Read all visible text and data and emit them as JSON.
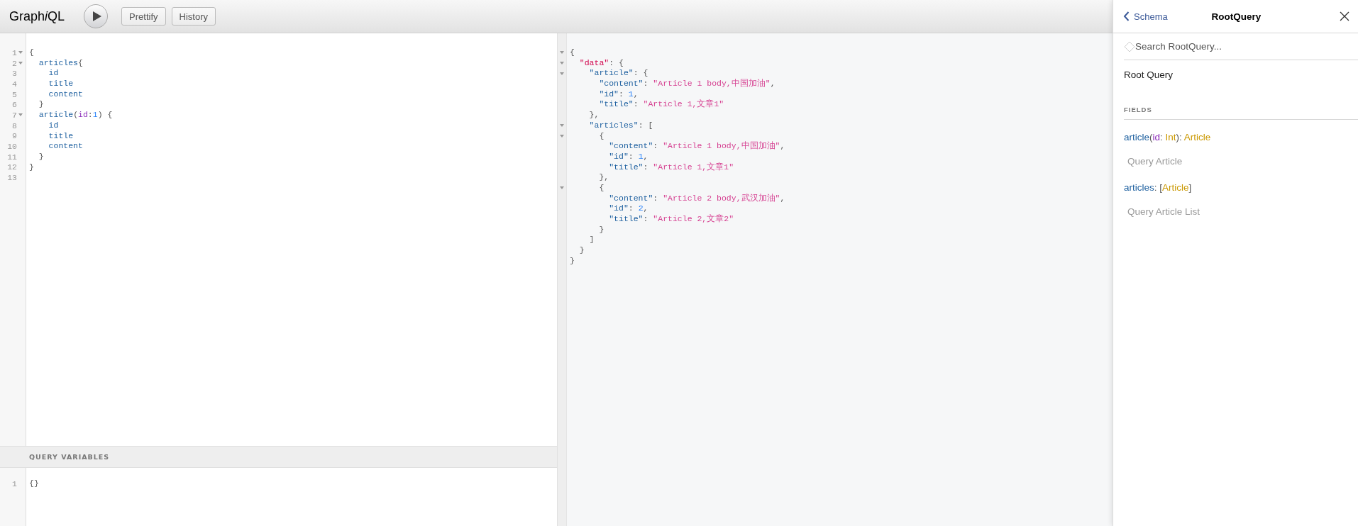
{
  "toolbar": {
    "title": [
      {
        "text": "Graph",
        "italic": false
      },
      {
        "text": "i",
        "italic": true
      },
      {
        "text": "QL",
        "italic": false
      }
    ],
    "buttons": [
      {
        "label": "Prettify"
      },
      {
        "label": "History"
      }
    ]
  },
  "query_editor": {
    "lines": [
      {
        "number": "1",
        "foldable": true,
        "tokens": [
          {
            "kind": "punct",
            "text": "{"
          }
        ]
      },
      {
        "number": "2",
        "foldable": true,
        "tokens": [
          {
            "kind": "field",
            "text": "  articles"
          },
          {
            "kind": "punct",
            "text": "{"
          }
        ]
      },
      {
        "number": "3",
        "foldable": false,
        "tokens": [
          {
            "kind": "field",
            "text": "    id"
          }
        ]
      },
      {
        "number": "4",
        "foldable": false,
        "tokens": [
          {
            "kind": "field",
            "text": "    title"
          }
        ]
      },
      {
        "number": "5",
        "foldable": false,
        "tokens": [
          {
            "kind": "field",
            "text": "    content"
          }
        ]
      },
      {
        "number": "6",
        "foldable": false,
        "tokens": [
          {
            "kind": "punct",
            "text": "  }"
          }
        ]
      },
      {
        "number": "7",
        "foldable": true,
        "tokens": [
          {
            "kind": "field",
            "text": "  article"
          },
          {
            "kind": "punct",
            "text": "("
          },
          {
            "kind": "attribute",
            "text": "id"
          },
          {
            "kind": "punct",
            "text": ":"
          },
          {
            "kind": "number",
            "text": "1"
          },
          {
            "kind": "punct",
            "text": ") {"
          }
        ]
      },
      {
        "number": "8",
        "foldable": false,
        "tokens": [
          {
            "kind": "field",
            "text": "    id"
          }
        ]
      },
      {
        "number": "9",
        "foldable": false,
        "tokens": [
          {
            "kind": "field",
            "text": "    title"
          }
        ]
      },
      {
        "number": "10",
        "foldable": false,
        "tokens": [
          {
            "kind": "field",
            "text": "    content"
          }
        ]
      },
      {
        "number": "11",
        "foldable": false,
        "tokens": [
          {
            "kind": "punct",
            "text": "  }"
          }
        ]
      },
      {
        "number": "12",
        "foldable": false,
        "tokens": [
          {
            "kind": "punct",
            "text": "}"
          }
        ]
      },
      {
        "number": "13",
        "foldable": false
      }
    ]
  },
  "variables": {
    "title": "QUERY VARIABLES",
    "lines": [
      {
        "number": "1",
        "tokens": [
          {
            "kind": "punct",
            "text": "{}"
          }
        ]
      }
    ]
  },
  "results": {
    "lines": [
      {
        "foldable": true,
        "tokens": [
          {
            "kind": "punct",
            "text": "{"
          }
        ]
      },
      {
        "foldable": true,
        "tokens": [
          {
            "kind": "def",
            "text": "  \"data\""
          },
          {
            "kind": "punct",
            "text": ": {"
          }
        ]
      },
      {
        "foldable": true,
        "tokens": [
          {
            "kind": "property",
            "text": "    \"article\""
          },
          {
            "kind": "punct",
            "text": ": {"
          }
        ]
      },
      {
        "foldable": false,
        "tokens": [
          {
            "kind": "property",
            "text": "      \"content\""
          },
          {
            "kind": "punct",
            "text": ": "
          },
          {
            "kind": "string",
            "text": "\"Article 1 body,中国加油\""
          },
          {
            "kind": "punct",
            "text": ","
          }
        ]
      },
      {
        "foldable": false,
        "tokens": [
          {
            "kind": "property",
            "text": "      \"id\""
          },
          {
            "kind": "punct",
            "text": ": "
          },
          {
            "kind": "number",
            "text": "1"
          },
          {
            "kind": "punct",
            "text": ","
          }
        ]
      },
      {
        "foldable": false,
        "tokens": [
          {
            "kind": "property",
            "text": "      \"title\""
          },
          {
            "kind": "punct",
            "text": ": "
          },
          {
            "kind": "string",
            "text": "\"Article 1,文章1\""
          }
        ]
      },
      {
        "foldable": false,
        "tokens": [
          {
            "kind": "punct",
            "text": "    },"
          }
        ]
      },
      {
        "foldable": true,
        "tokens": [
          {
            "kind": "property",
            "text": "    \"articles\""
          },
          {
            "kind": "punct",
            "text": ": ["
          }
        ]
      },
      {
        "foldable": true,
        "tokens": [
          {
            "kind": "punct",
            "text": "      {"
          }
        ]
      },
      {
        "foldable": false,
        "tokens": [
          {
            "kind": "property",
            "text": "        \"content\""
          },
          {
            "kind": "punct",
            "text": ": "
          },
          {
            "kind": "string",
            "text": "\"Article 1 body,中国加油\""
          },
          {
            "kind": "punct",
            "text": ","
          }
        ]
      },
      {
        "foldable": false,
        "tokens": [
          {
            "kind": "property",
            "text": "        \"id\""
          },
          {
            "kind": "punct",
            "text": ": "
          },
          {
            "kind": "number",
            "text": "1"
          },
          {
            "kind": "punct",
            "text": ","
          }
        ]
      },
      {
        "foldable": false,
        "tokens": [
          {
            "kind": "property",
            "text": "        \"title\""
          },
          {
            "kind": "punct",
            "text": ": "
          },
          {
            "kind": "string",
            "text": "\"Article 1,文章1\""
          }
        ]
      },
      {
        "foldable": false,
        "tokens": [
          {
            "kind": "punct",
            "text": "      },"
          }
        ]
      },
      {
        "foldable": true,
        "tokens": [
          {
            "kind": "punct",
            "text": "      {"
          }
        ]
      },
      {
        "foldable": false,
        "tokens": [
          {
            "kind": "property",
            "text": "        \"content\""
          },
          {
            "kind": "punct",
            "text": ": "
          },
          {
            "kind": "string",
            "text": "\"Article 2 body,武汉加油\""
          },
          {
            "kind": "punct",
            "text": ","
          }
        ]
      },
      {
        "foldable": false,
        "tokens": [
          {
            "kind": "property",
            "text": "        \"id\""
          },
          {
            "kind": "punct",
            "text": ": "
          },
          {
            "kind": "number",
            "text": "2"
          },
          {
            "kind": "punct",
            "text": ","
          }
        ]
      },
      {
        "foldable": false,
        "tokens": [
          {
            "kind": "property",
            "text": "        \"title\""
          },
          {
            "kind": "punct",
            "text": ": "
          },
          {
            "kind": "string",
            "text": "\"Article 2,文章2\""
          }
        ]
      },
      {
        "foldable": false,
        "tokens": [
          {
            "kind": "punct",
            "text": "      }"
          }
        ]
      },
      {
        "foldable": false,
        "tokens": [
          {
            "kind": "punct",
            "text": "    ]"
          }
        ]
      },
      {
        "foldable": false,
        "tokens": [
          {
            "kind": "punct",
            "text": "  }"
          }
        ]
      },
      {
        "foldable": false,
        "tokens": [
          {
            "kind": "punct",
            "text": "}"
          }
        ]
      }
    ]
  },
  "docs": {
    "back_label": "Schema",
    "title": "RootQuery",
    "search": {
      "placeholder": "Search RootQuery..."
    },
    "description": "Root Query",
    "section_title": "FIELDS",
    "fields": [
      {
        "signature": [
          {
            "kind": "field",
            "text": "article"
          },
          {
            "kind": "punct",
            "text": "("
          },
          {
            "kind": "arg",
            "text": "id"
          },
          {
            "kind": "punct",
            "text": ": "
          },
          {
            "kind": "type",
            "text": "Int"
          },
          {
            "kind": "punct",
            "text": "): "
          },
          {
            "kind": "type",
            "text": "Article"
          }
        ],
        "description": "Query Article"
      },
      {
        "signature": [
          {
            "kind": "field",
            "text": "articles"
          },
          {
            "kind": "punct",
            "text": ": ["
          },
          {
            "kind": "type",
            "text": "Article"
          },
          {
            "kind": "punct",
            "text": "]"
          }
        ],
        "description": "Query Article List"
      }
    ]
  }
}
